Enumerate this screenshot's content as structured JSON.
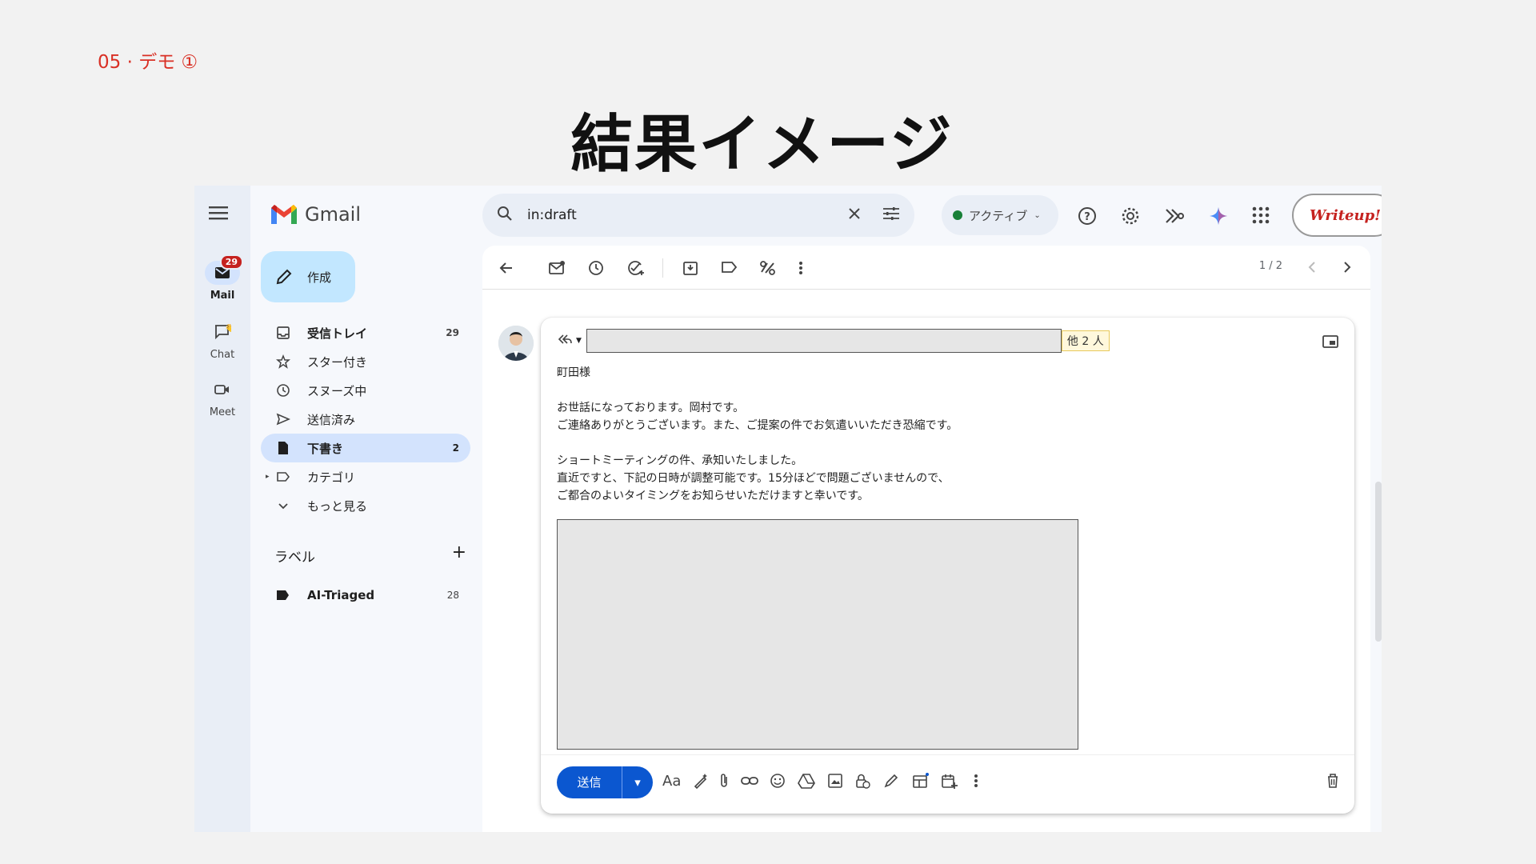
{
  "slide": {
    "label": "05 · デモ ①",
    "title": "結果イメージ"
  },
  "rail": {
    "mail": {
      "label": "Mail",
      "badge": "29"
    },
    "chat": {
      "label": "Chat"
    },
    "meet": {
      "label": "Meet"
    }
  },
  "app": {
    "name": "Gmail"
  },
  "compose": {
    "label": "作成"
  },
  "nav": {
    "items": [
      {
        "label": "受信トレイ",
        "count": "29",
        "icon": "inbox-icon"
      },
      {
        "label": "スター付き",
        "count": "",
        "icon": "star-icon"
      },
      {
        "label": "スヌーズ中",
        "count": "",
        "icon": "clock-icon"
      },
      {
        "label": "送信済み",
        "count": "",
        "icon": "send-icon"
      },
      {
        "label": "下書き",
        "count": "2",
        "icon": "draft-icon"
      },
      {
        "label": "カテゴリ",
        "count": "",
        "icon": "label-icon"
      },
      {
        "label": "もっと見る",
        "count": "",
        "icon": "chevron-down-icon"
      }
    ],
    "labels_heading": "ラベル",
    "label_item": {
      "label": "AI-Triaged",
      "count": "28"
    }
  },
  "search": {
    "query": "in:draft"
  },
  "status": {
    "label": "アクティブ"
  },
  "writeup": {
    "label": "Writeup!"
  },
  "pager": {
    "text": "1 / 2"
  },
  "draft": {
    "others": "他 2 人",
    "lines": [
      "町田様",
      "",
      "お世話になっております。岡村です。",
      "ご連絡ありがとうございます。また、ご提案の件でお気遣いいただき恐縮です。",
      "",
      "ショートミーティングの件、承知いたしました。",
      "直近ですと、下記の日時が調整可能です。15分ほどで問題ございませんので、",
      "ご都合のよいタイミングをお知らせいただけますと幸いです。"
    ],
    "send_label": "送信",
    "format_label": "Aa"
  },
  "colors": {
    "accent": "#0b57d0",
    "slide_label": "#d93025",
    "compose_bg": "#c2e7ff",
    "active_nav": "#d3e3fd"
  }
}
